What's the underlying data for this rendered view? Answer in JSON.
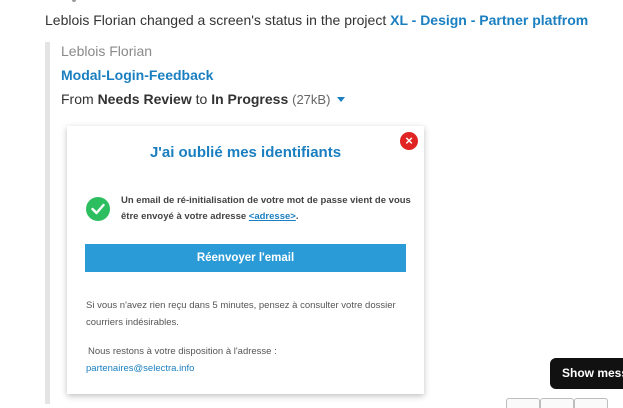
{
  "notification": {
    "actor": "Leblois Florian",
    "action": "changed a screen's status in the project",
    "project": "XL - Design - Partner platfrom"
  },
  "activity": {
    "author": "Leblois Florian",
    "screen_name": "Modal-Login-Feedback",
    "from_word": "From",
    "from_status": "Needs Review",
    "to_word": "to",
    "to_status": "In Progress",
    "file_size": "(27kB)"
  },
  "preview": {
    "title": "J'ai oublié mes identifiants",
    "close_symbol": "×",
    "message_pre": "Un email de ré-initialisation de votre mot de passe vient de vous être envoyé à votre adresse",
    "message_link": "<adresse>",
    "message_post": ".",
    "resend_button": "Réenvoyer l'email",
    "hint": "Si vous n'avez rien reçu dans 5 minutes, pensez à consulter votre dossier courriers indésirables.",
    "contact_line": "Nous restons à votre disposition à l'adresse :",
    "contact_email": "partenaires@selectra.info"
  },
  "show_button": "Show mess",
  "colors": {
    "link": "#1a7fc0",
    "success": "#2dbe60",
    "danger": "#e02424",
    "button": "#2a9bd6"
  },
  "icons": [
    "close-icon",
    "check-icon",
    "caret-down-icon"
  ]
}
